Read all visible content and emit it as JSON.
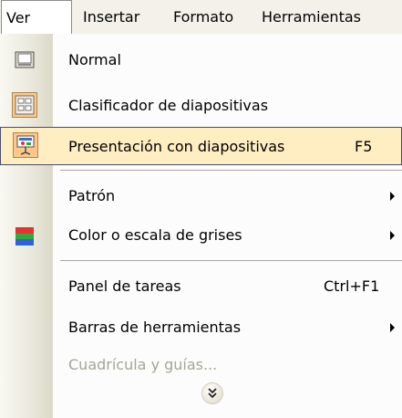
{
  "menubar": {
    "items": [
      {
        "label": "Ver",
        "active": true
      },
      {
        "label": "Insertar"
      },
      {
        "label": "Formato"
      },
      {
        "label": "Herramientas"
      }
    ]
  },
  "menu": {
    "items": [
      {
        "label": "Normal",
        "icon": "normal-view-icon"
      },
      {
        "label": "Clasificador de diapositivas",
        "icon": "slide-sorter-icon"
      },
      {
        "label": "Presentación con diapositivas",
        "shortcut": "F5",
        "icon": "slideshow-icon",
        "highlighted": true
      },
      {
        "label": "Patrón",
        "submenu": true
      },
      {
        "label": "Color o escala de grises",
        "icon": "color-grayscale-icon",
        "submenu": true
      },
      {
        "label": "Panel de tareas",
        "shortcut": "Ctrl+F1"
      },
      {
        "label": "Barras de herramientas",
        "submenu": true
      },
      {
        "label": "Cuadrícula y guías...",
        "disabled": true
      }
    ],
    "expand_icon": "double-chevron-down-icon"
  }
}
